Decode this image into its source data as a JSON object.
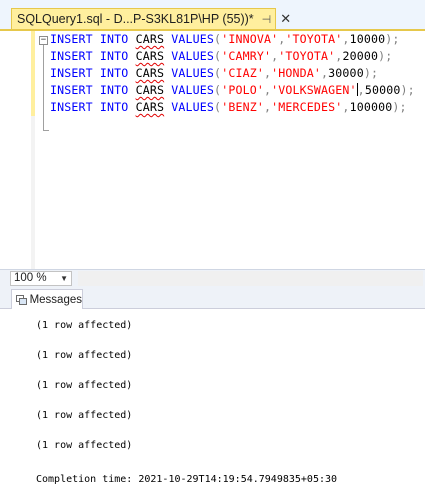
{
  "tab": {
    "title": "SQLQuery1.sql - D...P-S3KL81P\\HP (55))*",
    "pin_icon": "pin-icon",
    "close_icon": "close-icon"
  },
  "editor": {
    "lines": [
      {
        "kw1": "INSERT",
        "kw2": "INTO",
        "table": "CARS",
        "kw3": "VALUES",
        "open": "(",
        "model": "'INNOVA'",
        "comma1": ",",
        "brand": "'TOYOTA'",
        "comma2": ",",
        "price": "10000",
        "close": ");"
      },
      {
        "kw1": "INSERT",
        "kw2": "INTO",
        "table": "CARS",
        "kw3": "VALUES",
        "open": "(",
        "model": "'CAMRY'",
        "comma1": ",",
        "brand": "'TOYOTA'",
        "comma2": ",",
        "price": "20000",
        "close": ");"
      },
      {
        "kw1": "INSERT",
        "kw2": "INTO",
        "table": "CARS",
        "kw3": "VALUES",
        "open": "(",
        "model": "'CIAZ'",
        "comma1": ",",
        "brand": "'HONDA'",
        "comma2": ",",
        "price": "30000",
        "close": ");"
      },
      {
        "kw1": "INSERT",
        "kw2": "INTO",
        "table": "CARS",
        "kw3": "VALUES",
        "open": "(",
        "model": "'POLO'",
        "comma1": ",",
        "brand": "'VOLKSWAGEN'",
        "comma2": ",",
        "price": "50000",
        "close": ");"
      },
      {
        "kw1": "INSERT",
        "kw2": "INTO",
        "table": "CARS",
        "kw3": "VALUES",
        "open": "(",
        "model": "'BENZ'",
        "comma1": ",",
        "brand": "'MERCEDES'",
        "comma2": ",",
        "price": "100000",
        "close": ");"
      }
    ],
    "fold_symbol": "−"
  },
  "zoom": {
    "value": "100 %",
    "arrow": "▼"
  },
  "results": {
    "tab_label": "Messages",
    "messages": [
      "(1 row affected)",
      "(1 row affected)",
      "(1 row affected)",
      "(1 row affected)",
      "(1 row affected)"
    ],
    "completion": "Completion time: 2021-10-29T14:19:54.7949835+05:30"
  },
  "colors": {
    "keyword": "#0000ff",
    "string": "#ff0000",
    "punctuation": "#808080",
    "active_tab": "#ffef9e"
  }
}
